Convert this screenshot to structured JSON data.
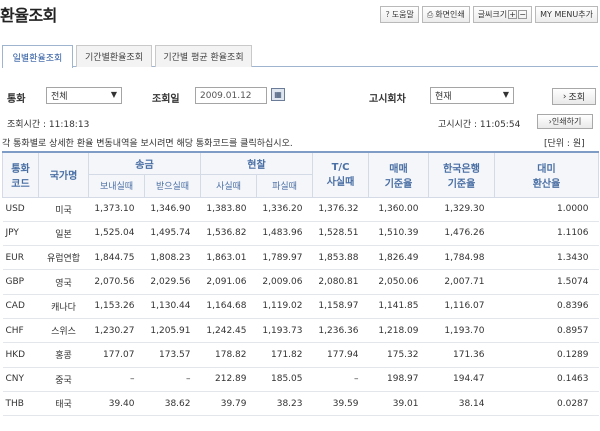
{
  "page": {
    "title": "환율조회"
  },
  "toolbar": {
    "help": "도움말",
    "print_screen": "화면인쇄",
    "font_size": "글씨크기",
    "font_plus": "+",
    "font_minus": "−",
    "my_menu": "MY MENU추가"
  },
  "tabs": [
    {
      "label": "일별환율조회",
      "active": true
    },
    {
      "label": "기간별환율조회",
      "active": false
    },
    {
      "label": "기간별 평균 환율조회",
      "active": false
    }
  ],
  "filter": {
    "currency_label": "통화",
    "currency_value": "전체",
    "date_label": "조회일",
    "date_value": "2009.01.12",
    "notice_round_label": "고시회차",
    "notice_round_value": "현재",
    "query_button": "조회"
  },
  "info": {
    "query_time": "조회시간 : 11:18:13",
    "notice_time": "고시시간 : 11:05:54",
    "print_button": "인쇄하기",
    "instruction": "각 통화별로 상세한 환율 변동내역을 보시려면 해당 통화코드를 클릭하십시오.",
    "unit": "[단위 : 원]"
  },
  "table": {
    "headers": {
      "currency_code": "통화\n코드",
      "country": "국가명",
      "remit": "송금",
      "remit_send": "보내실때",
      "remit_receive": "받으실때",
      "cash": "현찰",
      "cash_buy": "사실때",
      "cash_sell": "파실때",
      "tc_buy": "T/C\n사실때",
      "trade_base": "매매\n기준율",
      "bok_base": "한국은행\n기준율",
      "usd_conv": "대미\n환산율"
    },
    "rows": [
      {
        "code": "USD",
        "country": "미국",
        "remit_send": "1,373.10",
        "remit_receive": "1,346.90",
        "cash_buy": "1,383.80",
        "cash_sell": "1,336.20",
        "tc_buy": "1,376.32",
        "trade_base": "1,360.00",
        "bok_base": "1,329.30",
        "usd_conv": "1.0000"
      },
      {
        "code": "JPY",
        "country": "일본",
        "remit_send": "1,525.04",
        "remit_receive": "1,495.74",
        "cash_buy": "1,536.82",
        "cash_sell": "1,483.96",
        "tc_buy": "1,528.51",
        "trade_base": "1,510.39",
        "bok_base": "1,476.26",
        "usd_conv": "1.1106"
      },
      {
        "code": "EUR",
        "country": "유럽연합",
        "remit_send": "1,844.75",
        "remit_receive": "1,808.23",
        "cash_buy": "1,863.01",
        "cash_sell": "1,789.97",
        "tc_buy": "1,853.88",
        "trade_base": "1,826.49",
        "bok_base": "1,784.98",
        "usd_conv": "1.3430"
      },
      {
        "code": "GBP",
        "country": "영국",
        "remit_send": "2,070.56",
        "remit_receive": "2,029.56",
        "cash_buy": "2,091.06",
        "cash_sell": "2,009.06",
        "tc_buy": "2,080.81",
        "trade_base": "2,050.06",
        "bok_base": "2,007.71",
        "usd_conv": "1.5074"
      },
      {
        "code": "CAD",
        "country": "캐나다",
        "remit_send": "1,153.26",
        "remit_receive": "1,130.44",
        "cash_buy": "1,164.68",
        "cash_sell": "1,119.02",
        "tc_buy": "1,158.97",
        "trade_base": "1,141.85",
        "bok_base": "1,116.07",
        "usd_conv": "0.8396"
      },
      {
        "code": "CHF",
        "country": "스위스",
        "remit_send": "1,230.27",
        "remit_receive": "1,205.91",
        "cash_buy": "1,242.45",
        "cash_sell": "1,193.73",
        "tc_buy": "1,236.36",
        "trade_base": "1,218.09",
        "bok_base": "1,193.70",
        "usd_conv": "0.8957"
      },
      {
        "code": "HKD",
        "country": "홍콩",
        "remit_send": "177.07",
        "remit_receive": "173.57",
        "cash_buy": "178.82",
        "cash_sell": "171.82",
        "tc_buy": "177.94",
        "trade_base": "175.32",
        "bok_base": "171.36",
        "usd_conv": "0.1289"
      },
      {
        "code": "CNY",
        "country": "중국",
        "remit_send": "–",
        "remit_receive": "–",
        "cash_buy": "212.89",
        "cash_sell": "185.05",
        "tc_buy": "–",
        "trade_base": "198.97",
        "bok_base": "194.47",
        "usd_conv": "0.1463"
      },
      {
        "code": "THB",
        "country": "태국",
        "remit_send": "39.40",
        "remit_receive": "38.62",
        "cash_buy": "39.79",
        "cash_sell": "38.23",
        "tc_buy": "39.59",
        "trade_base": "39.01",
        "bok_base": "38.14",
        "usd_conv": "0.0287"
      }
    ]
  }
}
